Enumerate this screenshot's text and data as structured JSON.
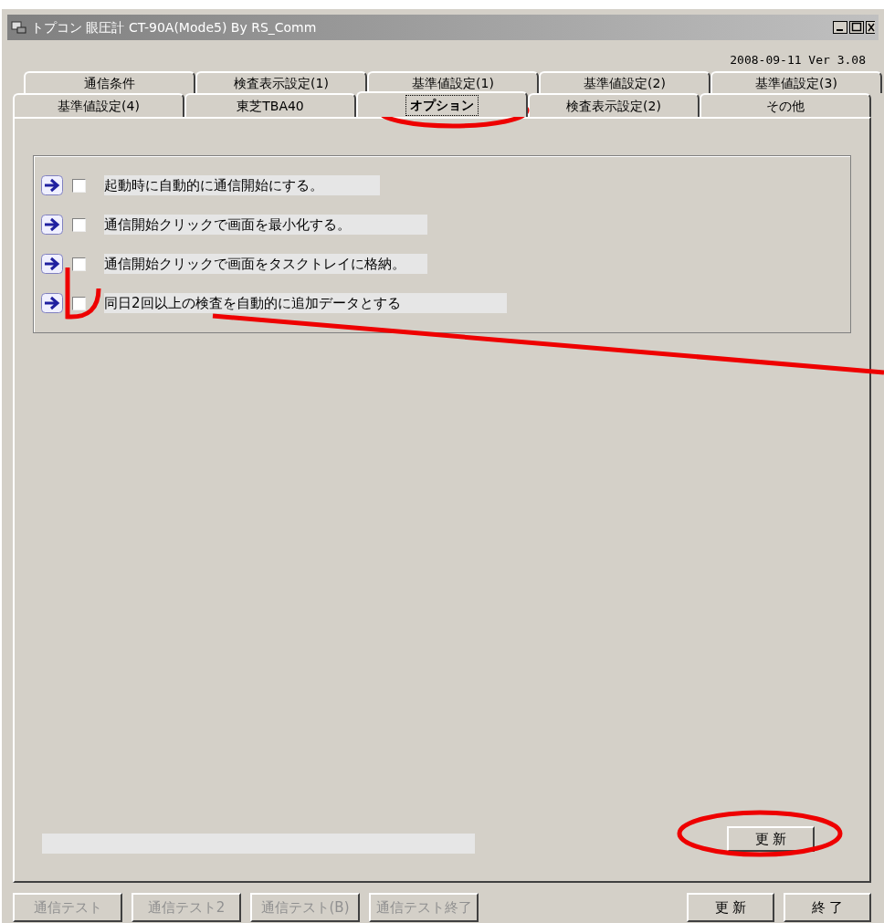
{
  "window": {
    "title": "トプコン 眼圧計 CT-90A(Mode5) By RS_Comm"
  },
  "version": "2008-09-11 Ver 3.08",
  "tab_rows": [
    [
      {
        "label": "通信条件",
        "selected": false
      },
      {
        "label": "検査表示設定(1)",
        "selected": false
      },
      {
        "label": "基準値設定(1)",
        "selected": false
      },
      {
        "label": "基準値設定(2)",
        "selected": false
      },
      {
        "label": "基準値設定(3)",
        "selected": false
      }
    ],
    [
      {
        "label": "基準値設定(4)",
        "selected": false
      },
      {
        "label": "東芝TBA40",
        "selected": false
      },
      {
        "label": "オプション",
        "selected": true
      },
      {
        "label": "検査表示設定(2)",
        "selected": false
      },
      {
        "label": "その他",
        "selected": false
      }
    ]
  ],
  "options": [
    {
      "label": "起動時に自動的に通信開始にする。",
      "checked": false
    },
    {
      "label": "通信開始クリックで画面を最小化する。",
      "checked": false
    },
    {
      "label": "通信開始クリックで画面をタスクトレイに格納。",
      "checked": false
    },
    {
      "label": "同日2回以上の検査を自動的に追加データとする",
      "checked": false
    }
  ],
  "panel_button": "更 新",
  "bottom_buttons": [
    {
      "label": "通信テスト",
      "disabled": true
    },
    {
      "label": "通信テスト2",
      "disabled": true
    },
    {
      "label": "通信テスト(B)",
      "disabled": true
    },
    {
      "label": "通信テスト終了",
      "disabled": true
    }
  ],
  "right_buttons": [
    {
      "label": "更 新",
      "disabled": false
    },
    {
      "label": "終 了",
      "disabled": false
    }
  ]
}
